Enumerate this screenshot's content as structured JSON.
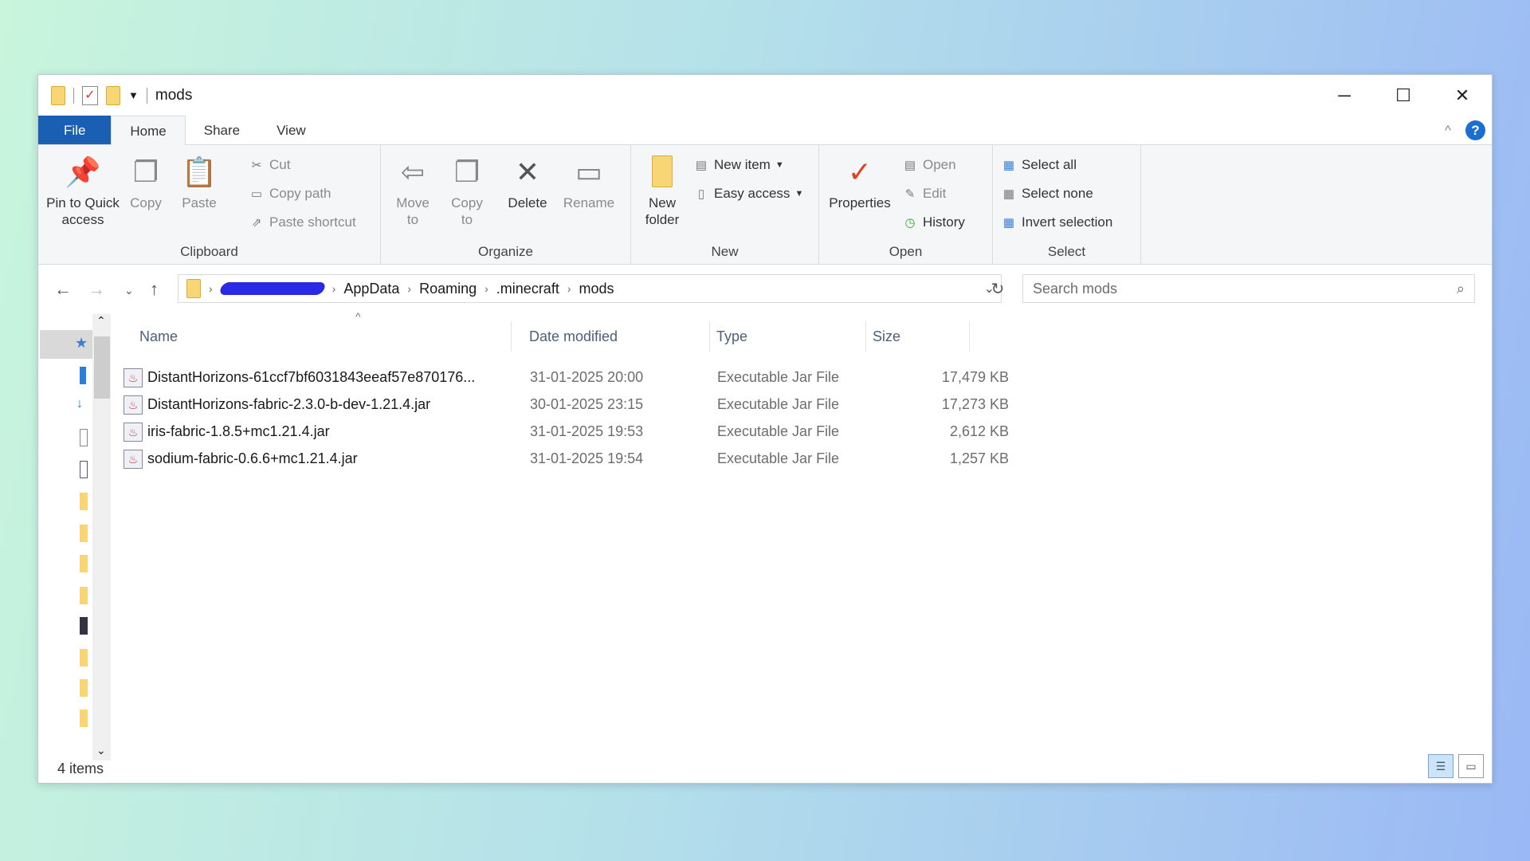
{
  "window": {
    "title": "mods",
    "minimize": "─",
    "maximize": "☐",
    "close": "✕"
  },
  "tabs": {
    "file": "File",
    "home": "Home",
    "share": "Share",
    "view": "View",
    "help": "?",
    "collapse": "^"
  },
  "ribbon": {
    "clipboard": {
      "label": "Clipboard",
      "pin": "Pin to Quick access",
      "copy": "Copy",
      "paste": "Paste",
      "cut": "Cut",
      "copy_path": "Copy path",
      "paste_shortcut": "Paste shortcut"
    },
    "organize": {
      "label": "Organize",
      "move_to": "Move to",
      "copy_to": "Copy to",
      "delete": "Delete",
      "rename": "Rename"
    },
    "new": {
      "label": "New",
      "new_folder": "New folder",
      "new_item": "New item",
      "easy_access": "Easy access"
    },
    "open": {
      "label": "Open",
      "properties": "Properties",
      "open": "Open",
      "edit": "Edit",
      "history": "History"
    },
    "select": {
      "label": "Select",
      "select_all": "Select all",
      "select_none": "Select none",
      "invert": "Invert selection"
    }
  },
  "address": {
    "crumbs": [
      "AppData",
      "Roaming",
      ".minecraft",
      "mods"
    ],
    "search_placeholder": "Search mods"
  },
  "columns": {
    "name": "Name",
    "date": "Date modified",
    "type": "Type",
    "size": "Size"
  },
  "files": [
    {
      "name": "DistantHorizons-61ccf7bf6031843eeaf57e870176...",
      "date": "31-01-2025 20:00",
      "type": "Executable Jar File",
      "size": "17,479 KB"
    },
    {
      "name": "DistantHorizons-fabric-2.3.0-b-dev-1.21.4.jar",
      "date": "30-01-2025 23:15",
      "type": "Executable Jar File",
      "size": "17,273 KB"
    },
    {
      "name": "iris-fabric-1.8.5+mc1.21.4.jar",
      "date": "31-01-2025 19:53",
      "type": "Executable Jar File",
      "size": "2,612 KB"
    },
    {
      "name": "sodium-fabric-0.6.6+mc1.21.4.jar",
      "date": "31-01-2025 19:54",
      "type": "Executable Jar File",
      "size": "1,257 KB"
    }
  ],
  "status": {
    "count": "4 items"
  }
}
